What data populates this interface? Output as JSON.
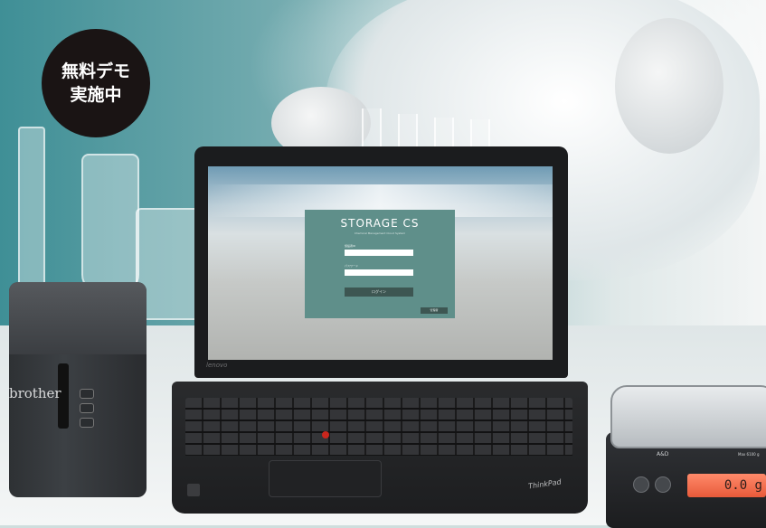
{
  "badge": {
    "line1": "無料デモ",
    "line2": "実施中"
  },
  "printer": {
    "brand": "brother"
  },
  "laptop": {
    "bezel_brand": "lenovo",
    "palm_brand": "ThinkPad",
    "login": {
      "title": "STORAGE CS",
      "subtitle": "Chemical Management Cloud System",
      "id_label": "施設者ID",
      "password_label": "パスワード",
      "login_button": "ログイン",
      "admin_button": "管理者"
    }
  },
  "scale": {
    "brand": "A&D",
    "model": "Max 6100 g",
    "reading": "0.0 g"
  },
  "colors": {
    "badge": "#1a1414",
    "login_panel": "#5f8f8a",
    "trackpoint": "#c9261d",
    "scale_display": "#ff8a6a"
  }
}
